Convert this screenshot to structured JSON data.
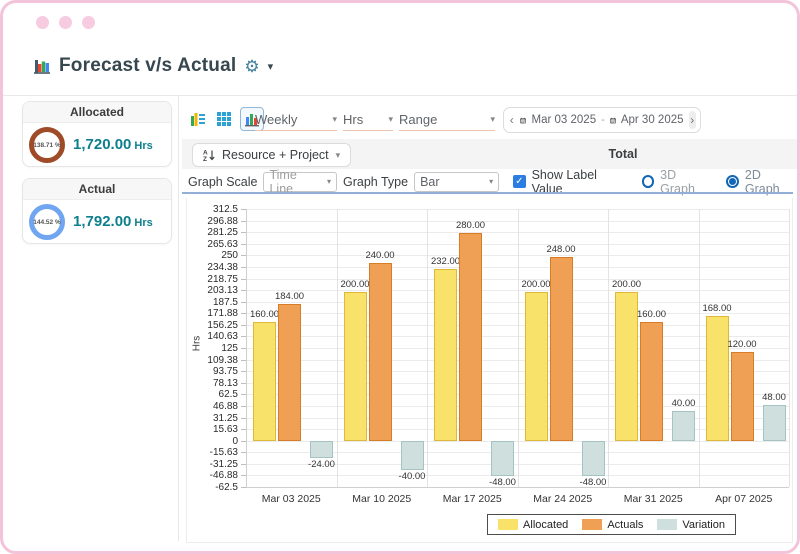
{
  "header": {
    "title": "Forecast v/s Actual"
  },
  "icons": {
    "gear": "⚙",
    "caret_down": "▾",
    "chevron_down": "▾",
    "prev": "‹",
    "next": "›",
    "check": "✓"
  },
  "sidebar": {
    "cards": [
      {
        "label": "Allocated",
        "percent": "138.71 %",
        "value": "1,720.00",
        "unit": "Hrs",
        "ring_color": "#a04b28"
      },
      {
        "label": "Actual",
        "percent": "144.52 %",
        "value": "1,792.00",
        "unit": "Hrs",
        "ring_color": "#70a5f1"
      }
    ]
  },
  "toolbar": {
    "selects": [
      {
        "label": "Weekly"
      },
      {
        "label": "Hrs"
      },
      {
        "label": "Range"
      }
    ],
    "date_range": {
      "start": "Mar 03 2025",
      "separator": "-",
      "end": "Apr 30 2025"
    }
  },
  "filter_row": {
    "dropdown": "Resource + Project",
    "total_label": "Total"
  },
  "controls": {
    "graph_scale_label": "Graph Scale",
    "graph_scale_value": "Time Line",
    "graph_type_label": "Graph Type",
    "graph_type_value": "Bar",
    "show_label_value": "Show Label Value",
    "show_label_checked": true,
    "radio_3d": "3D Graph",
    "radio_2d": "2D Graph",
    "selected_radio": "2d"
  },
  "chart_data": {
    "type": "bar",
    "title": "",
    "xlabel": "",
    "ylabel": "Hrs",
    "categories": [
      "Mar 03 2025",
      "Mar 10 2025",
      "Mar 17 2025",
      "Mar 24 2025",
      "Mar 31 2025",
      "Apr 07 2025"
    ],
    "series": [
      {
        "name": "Allocated",
        "color": "#f8e26a",
        "border": "#ddb83a",
        "values": [
          160,
          200,
          232,
          200,
          200,
          168
        ]
      },
      {
        "name": "Actuals",
        "color": "#efa055",
        "border": "#d97c28",
        "values": [
          184,
          240,
          280,
          248,
          160,
          120
        ]
      },
      {
        "name": "Variation",
        "color": "#cfdfde",
        "border": "#a5c3c2",
        "values": [
          -24,
          -40,
          -48,
          -48,
          40,
          48
        ]
      }
    ],
    "ylim": [
      -62.5,
      312.5
    ],
    "yticks": [
      "312.5",
      "296.88",
      "281.25",
      "265.63",
      "250",
      "234.38",
      "218.75",
      "203.13",
      "187.5",
      "171.88",
      "156.25",
      "140.63",
      "125",
      "109.38",
      "93.75",
      "78.13",
      "62.5",
      "46.88",
      "31.25",
      "15.63",
      "0",
      "-15.63",
      "-31.25",
      "-46.88",
      "-62.5"
    ],
    "grid": true,
    "legend_position": "bottom-right",
    "value_label_decimals": 2
  }
}
